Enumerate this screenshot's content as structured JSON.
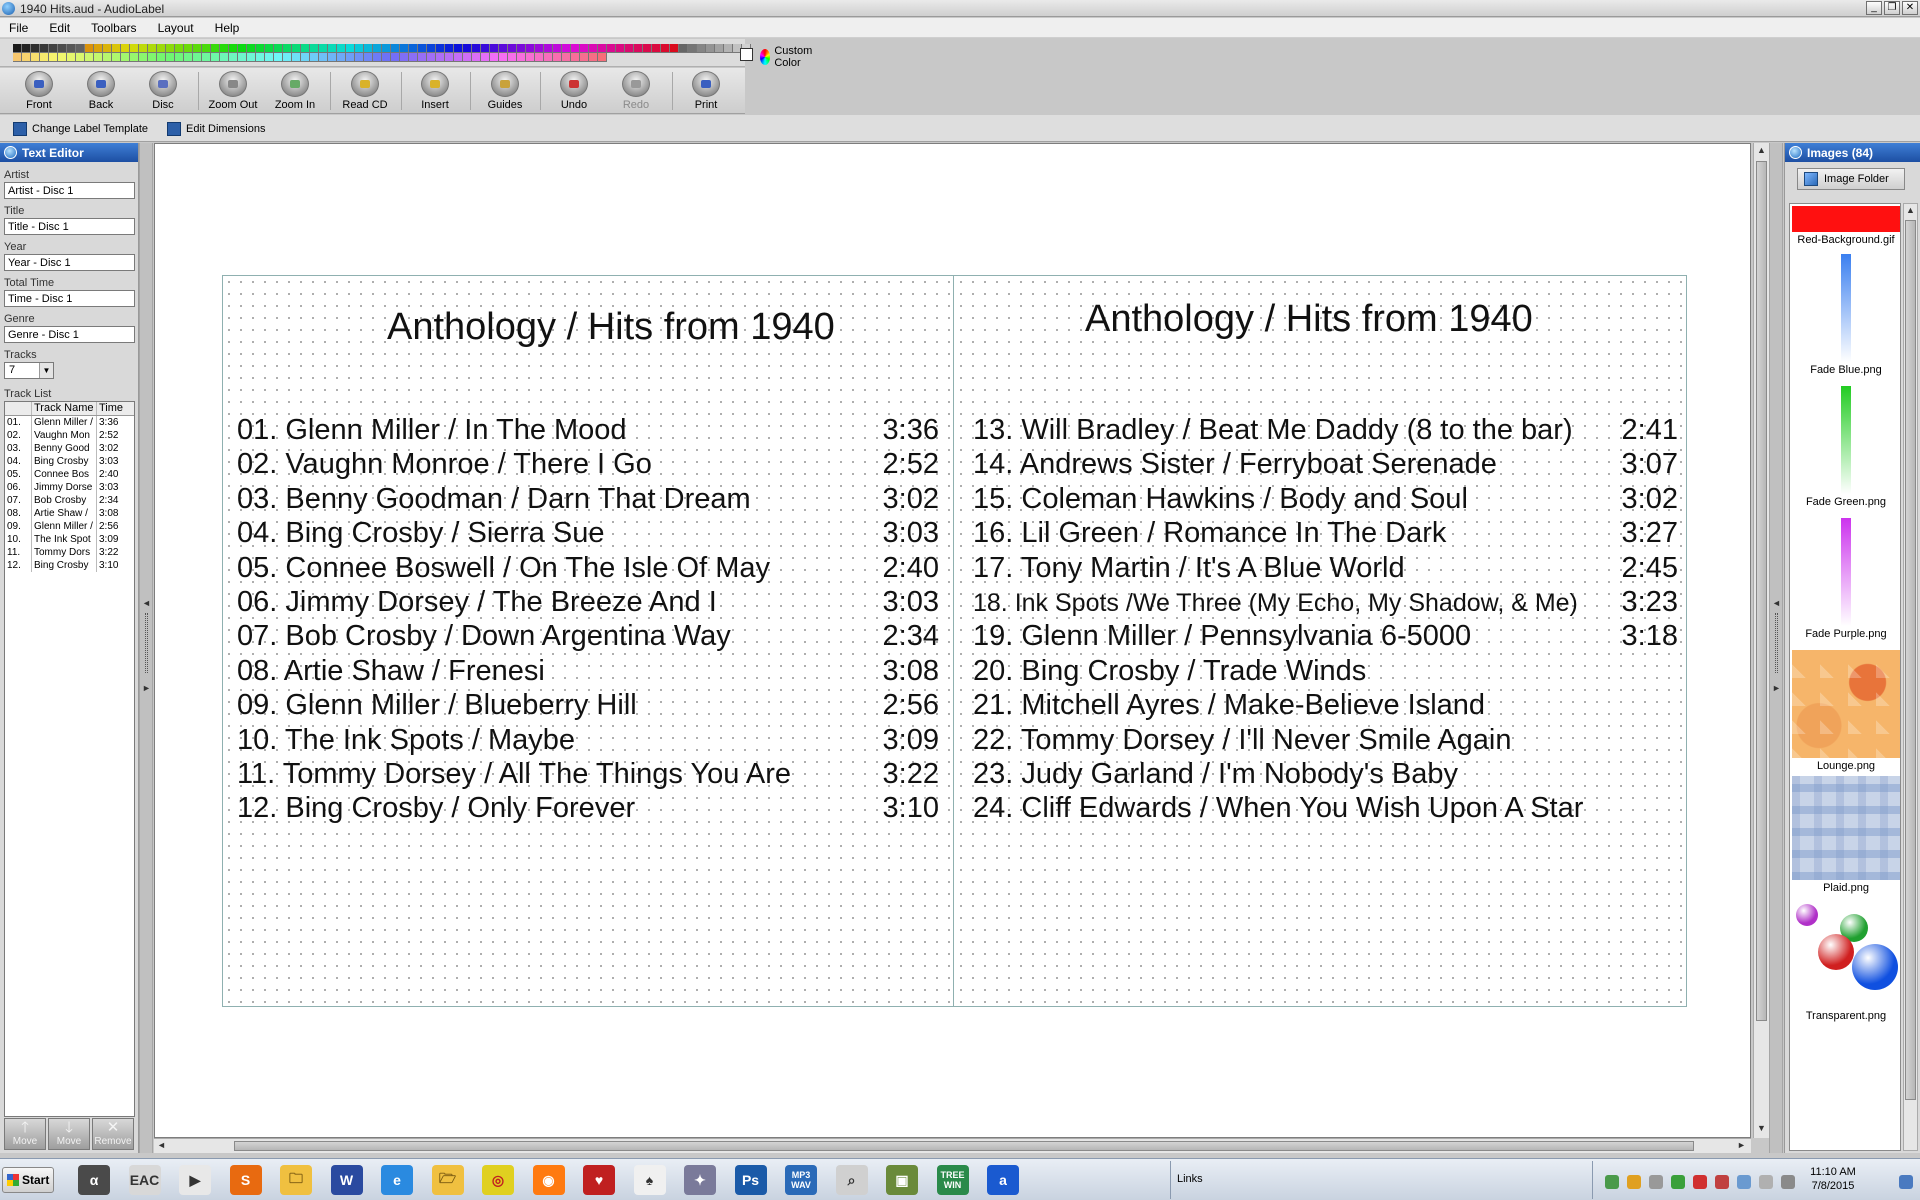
{
  "window": {
    "title": "1940 Hits.aud - AudioLabel"
  },
  "menu": [
    "File",
    "Edit",
    "Toolbars",
    "Layout",
    "Help"
  ],
  "palette": {
    "custom_color_label": "Custom Color"
  },
  "toolbar": {
    "front": "Front",
    "back": "Back",
    "disc": "Disc",
    "zoom_out": "Zoom Out",
    "zoom_in": "Zoom In",
    "read_cd": "Read CD",
    "insert": "Insert",
    "guides": "Guides",
    "undo": "Undo",
    "redo": "Redo",
    "print": "Print"
  },
  "template_bar": {
    "change_label_template": "Change Label Template",
    "edit_dimensions": "Edit Dimensions"
  },
  "text_editor": {
    "header": "Text Editor",
    "artist_label": "Artist",
    "artist_value": "Artist - Disc 1",
    "title_label": "Title",
    "title_value": "Title - Disc 1",
    "year_label": "Year",
    "year_value": "Year - Disc 1",
    "total_time_label": "Total Time",
    "total_time_value": "Time - Disc 1",
    "genre_label": "Genre",
    "genre_value": "Genre - Disc 1",
    "tracks_label": "Tracks",
    "tracks_value": "7",
    "track_list_label": "Track List",
    "col_track_name": "Track Name",
    "col_time": "Time",
    "tracks": [
      [
        "01.",
        "Glenn Miller /",
        "3:36"
      ],
      [
        "02.",
        "Vaughn Mon",
        "2:52"
      ],
      [
        "03.",
        "Benny Good",
        "3:02"
      ],
      [
        "04.",
        "Bing Crosby",
        "3:03"
      ],
      [
        "05.",
        "Connee Bos",
        "2:40"
      ],
      [
        "06.",
        "Jimmy Dorse",
        "3:03"
      ],
      [
        "07.",
        "Bob Crosby",
        "2:34"
      ],
      [
        "08.",
        "Artie Shaw /",
        "3:08"
      ],
      [
        "09.",
        "Glenn Miller /",
        "2:56"
      ],
      [
        "10.",
        "The Ink Spot",
        "3:09"
      ],
      [
        "11.",
        "Tommy Dors",
        "3:22"
      ],
      [
        "12.",
        "Bing Crosby",
        "3:10"
      ]
    ],
    "move_up": "Move",
    "move_down": "Move",
    "remove": "Remove"
  },
  "label": {
    "left_title": "Anthology / Hits from 1940",
    "right_title": "Anthology / Hits from 1940",
    "left_tracks": [
      [
        "01. Glenn Miller / In The Mood",
        "3:36"
      ],
      [
        "02. Vaughn Monroe / There I Go",
        "2:52"
      ],
      [
        "03. Benny Goodman / Darn That Dream",
        "3:02"
      ],
      [
        "04. Bing Crosby / Sierra Sue",
        "3:03"
      ],
      [
        "05. Connee Boswell / On The Isle Of May",
        "2:40"
      ],
      [
        "06. Jimmy Dorsey / The Breeze And I",
        "3:03"
      ],
      [
        "07. Bob Crosby / Down Argentina Way",
        "2:34"
      ],
      [
        "08. Artie Shaw / Frenesi",
        "3:08"
      ],
      [
        "09. Glenn Miller / Blueberry Hill",
        "2:56"
      ],
      [
        "10. The Ink Spots / Maybe",
        "3:09"
      ],
      [
        "11. Tommy Dorsey / All The Things You Are",
        "3:22"
      ],
      [
        "12. Bing Crosby / Only Forever",
        "3:10"
      ]
    ],
    "right_tracks": [
      [
        "13. Will Bradley / Beat Me Daddy (8 to the bar)",
        "2:41"
      ],
      [
        "14. Andrews Sister / Ferryboat Serenade",
        "3:07"
      ],
      [
        "15. Coleman Hawkins / Body and Soul",
        "3:02"
      ],
      [
        "16. Lil Green / Romance In The Dark",
        "3:27"
      ],
      [
        "17. Tony Martin / It's A Blue World",
        "2:45"
      ],
      [
        "18. Ink Spots /We Three (My Echo, My Shadow, & Me)",
        "3:23"
      ],
      [
        "19. Glenn Miller / Pennsylvania 6-5000",
        "3:18"
      ],
      [
        "20. Bing Crosby / Trade Winds",
        ""
      ],
      [
        "21. Mitchell Ayres / Make-Believe Island",
        ""
      ],
      [
        "22. Tommy Dorsey / I'll Never Smile Again",
        ""
      ],
      [
        "23. Judy Garland / I'm Nobody's Baby",
        ""
      ],
      [
        "24. Cliff Edwards / When You Wish Upon A Star",
        ""
      ]
    ]
  },
  "images_panel": {
    "header": "Images (84)",
    "folder_button": "Image Folder",
    "items": [
      "Red-Background.gif",
      "Fade Blue.png",
      "Fade Green.png",
      "Fade Purple.png",
      "Lounge.png",
      "Plaid.png",
      "Transparent.png"
    ]
  },
  "taskbar": {
    "start": "Start",
    "links": "Links",
    "clock_time": "11:10 AM",
    "clock_date": "7/8/2015",
    "icons": [
      "α",
      "EAC",
      "▶",
      "S",
      "🗀",
      "W",
      "e",
      "🗁",
      "◎",
      "◉",
      "♥",
      "♠",
      "✦",
      "Ps",
      "MP3 WAV",
      "⌕",
      "▣",
      "TREE WIN",
      "a"
    ]
  }
}
